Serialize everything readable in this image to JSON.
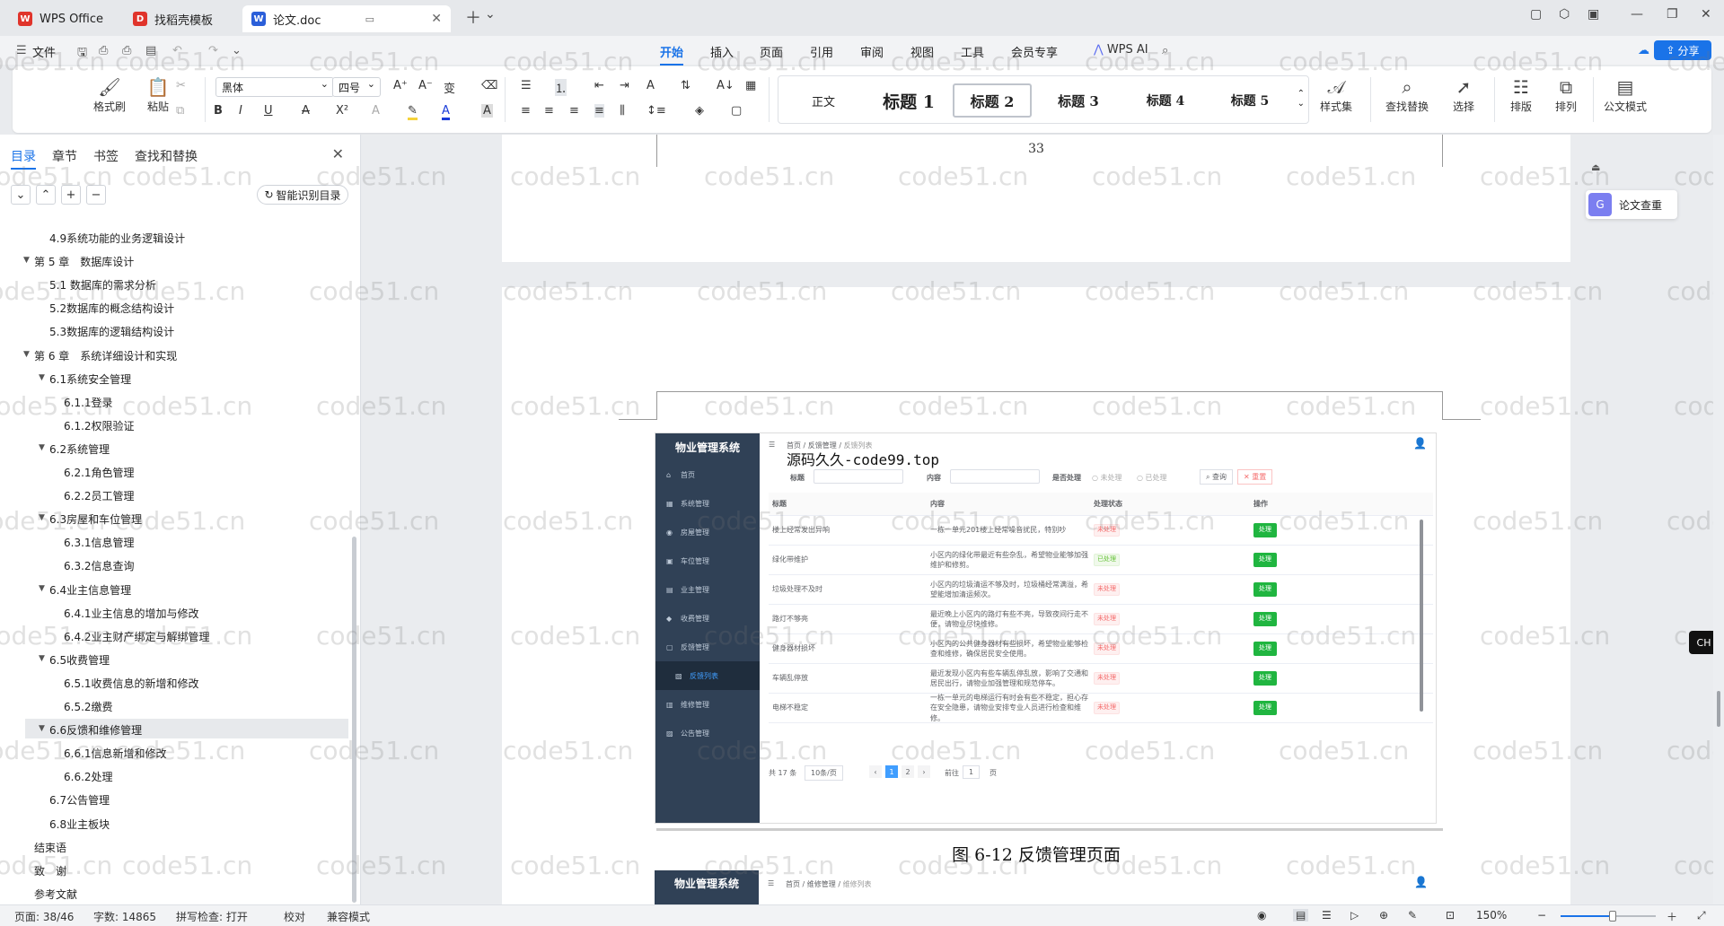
{
  "tabs": [
    {
      "label": "WPS Office",
      "logo": "W",
      "color": "#e0342b"
    },
    {
      "label": "找稻壳模板",
      "logo": "D",
      "color": "#e0342b"
    },
    {
      "label": "论文.doc",
      "logo": "W",
      "color": "#2b5fd9"
    }
  ],
  "menu": {
    "file": "文件",
    "items": [
      "开始",
      "插入",
      "页面",
      "引用",
      "审阅",
      "视图",
      "工具",
      "会员专享"
    ],
    "active": "开始",
    "ai": "WPS AI",
    "share": "分享"
  },
  "ribbon": {
    "format_painter": "格式刷",
    "paste": "粘贴",
    "font": "黑体",
    "size": "四号",
    "styles": [
      "正文",
      "标题 1",
      "标题 2",
      "标题 3",
      "标题 4",
      "标题 5"
    ],
    "style_set": "样式集",
    "find_replace": "查找替换",
    "select": "选择",
    "layout": "排版",
    "arrange": "排列",
    "official": "公文模式"
  },
  "nav": {
    "tabs": [
      "目录",
      "章节",
      "书签",
      "查找和替换"
    ],
    "smart_toc": "智能识别目录",
    "toc": [
      {
        "label": "4.9系统功能的业务逻辑设计",
        "level": 1
      },
      {
        "label": "第 5 章　数据库设计",
        "level": 0,
        "arrow": true
      },
      {
        "label": "5.1  数据库的需求分析",
        "level": 1
      },
      {
        "label": "5.2数据库的概念结构设计",
        "level": 1
      },
      {
        "label": "5.3数据库的逻辑结构设计",
        "level": 1
      },
      {
        "label": "第 6 章　系统详细设计和实现",
        "level": 0,
        "arrow": true
      },
      {
        "label": "6.1系统安全管理",
        "level": 1,
        "arrow": true
      },
      {
        "label": "6.1.1登录",
        "level": 2
      },
      {
        "label": "6.1.2权限验证",
        "level": 2
      },
      {
        "label": "6.2系统管理",
        "level": 1,
        "arrow": true
      },
      {
        "label": "6.2.1角色管理",
        "level": 2
      },
      {
        "label": "6.2.2员工管理",
        "level": 2
      },
      {
        "label": "6.3房屋和车位管理",
        "level": 1,
        "arrow": true
      },
      {
        "label": "6.3.1信息管理",
        "level": 2
      },
      {
        "label": "6.3.2信息查询",
        "level": 2
      },
      {
        "label": "6.4业主信息管理",
        "level": 1,
        "arrow": true
      },
      {
        "label": "6.4.1业主信息的增加与修改",
        "level": 2
      },
      {
        "label": "6.4.2业主财产绑定与解绑管理",
        "level": 2
      },
      {
        "label": "6.5收费管理",
        "level": 1,
        "arrow": true
      },
      {
        "label": "6.5.1收费信息的新增和修改",
        "level": 2
      },
      {
        "label": "6.5.2缴费",
        "level": 2
      },
      {
        "label": "6.6反馈和维修管理",
        "level": 1,
        "arrow": true,
        "selected": true
      },
      {
        "label": "6.6.1信息新增和修改",
        "level": 2
      },
      {
        "label": "6.6.2处理",
        "level": 2
      },
      {
        "label": "6.7公告管理",
        "level": 1
      },
      {
        "label": "6.8业主板块",
        "level": 1
      },
      {
        "label": "结束语",
        "level": 0
      },
      {
        "label": "致　谢",
        "level": 0
      },
      {
        "label": "参考文献",
        "level": 0
      }
    ]
  },
  "document": {
    "page_number": "33",
    "caption": "图 6-12  反馈管理页面",
    "overlay_text": "源码久久-code99.top",
    "screenshot": {
      "brand": "物业管理系统",
      "side_items": [
        {
          "icon": "⌂",
          "label": "首页"
        },
        {
          "icon": "▦",
          "label": "系统管理"
        },
        {
          "icon": "◉",
          "label": "房屋管理"
        },
        {
          "icon": "▣",
          "label": "车位管理"
        },
        {
          "icon": "▤",
          "label": "业主管理"
        },
        {
          "icon": "◆",
          "label": "收费管理"
        },
        {
          "icon": "▢",
          "label": "反馈管理"
        },
        {
          "icon": "▧",
          "label": "反馈列表",
          "sub": true
        },
        {
          "icon": "▥",
          "label": "维修管理"
        },
        {
          "icon": "▨",
          "label": "公告管理"
        }
      ],
      "breadcrumb": [
        "首页",
        "反馈管理",
        "反馈列表"
      ],
      "filters": {
        "title": "标题",
        "content": "内容",
        "status": "是否处理",
        "opt1": "未处理",
        "opt2": "已处理",
        "search": "查询",
        "reset": "重置"
      },
      "columns": [
        "标题",
        "内容",
        "处理状态",
        "操作"
      ],
      "rows": [
        {
          "title": "楼上经常发出异响",
          "content": "一栋一单元201楼上经常噪音扰民，特别吵",
          "status": "未处理",
          "ok": false
        },
        {
          "title": "绿化带维护",
          "content": "小区内的绿化带最近有些杂乱，希望物业能够加强维护和修剪。",
          "status": "已处理",
          "ok": true
        },
        {
          "title": "垃圾处理不及时",
          "content": "小区内的垃圾清运不够及时，垃圾桶经常满溢，希望能增加清运频次。",
          "status": "未处理",
          "ok": false
        },
        {
          "title": "路灯不够亮",
          "content": "最近晚上小区内的路灯有些不亮，导致夜间行走不便，请物业尽快维修。",
          "status": "未处理",
          "ok": false
        },
        {
          "title": "健身器材损坏",
          "content": "小区内的公共健身器材有些损坏，希望物业能够检查和维修，确保居民安全使用。",
          "status": "未处理",
          "ok": false
        },
        {
          "title": "车辆乱停放",
          "content": "最近发现小区内有些车辆乱停乱放，影响了交通和居民出行，请物业加强管理和规范停车。",
          "status": "未处理",
          "ok": false
        },
        {
          "title": "电梯不稳定",
          "content": "一栋一单元的电梯运行有时会有些不稳定，担心存在安全隐患，请物业安排专业人员进行检查和维修。",
          "status": "未处理",
          "ok": false
        }
      ],
      "op_label": "处理",
      "pagination": {
        "total": "共 17 条",
        "per_page": "10条/页",
        "pages": [
          "1",
          "2"
        ],
        "current": "1",
        "goto": "前往",
        "goto_value": "1",
        "page_unit": "页"
      },
      "brand2": "物业管理系统",
      "breadcrumb2": [
        "首页",
        "维修管理",
        "维修列表"
      ]
    }
  },
  "float": {
    "dup_check": "论文查重",
    "ime": "CH ♪ 简"
  },
  "watermark": "code51.cn",
  "status": {
    "page": "页面: 38/46",
    "words": "字数: 14865",
    "spell": "拼写检查: 打开",
    "proof": "校对",
    "compat": "兼容模式",
    "zoom": "150%",
    "zoom_fraction": 0.55
  }
}
